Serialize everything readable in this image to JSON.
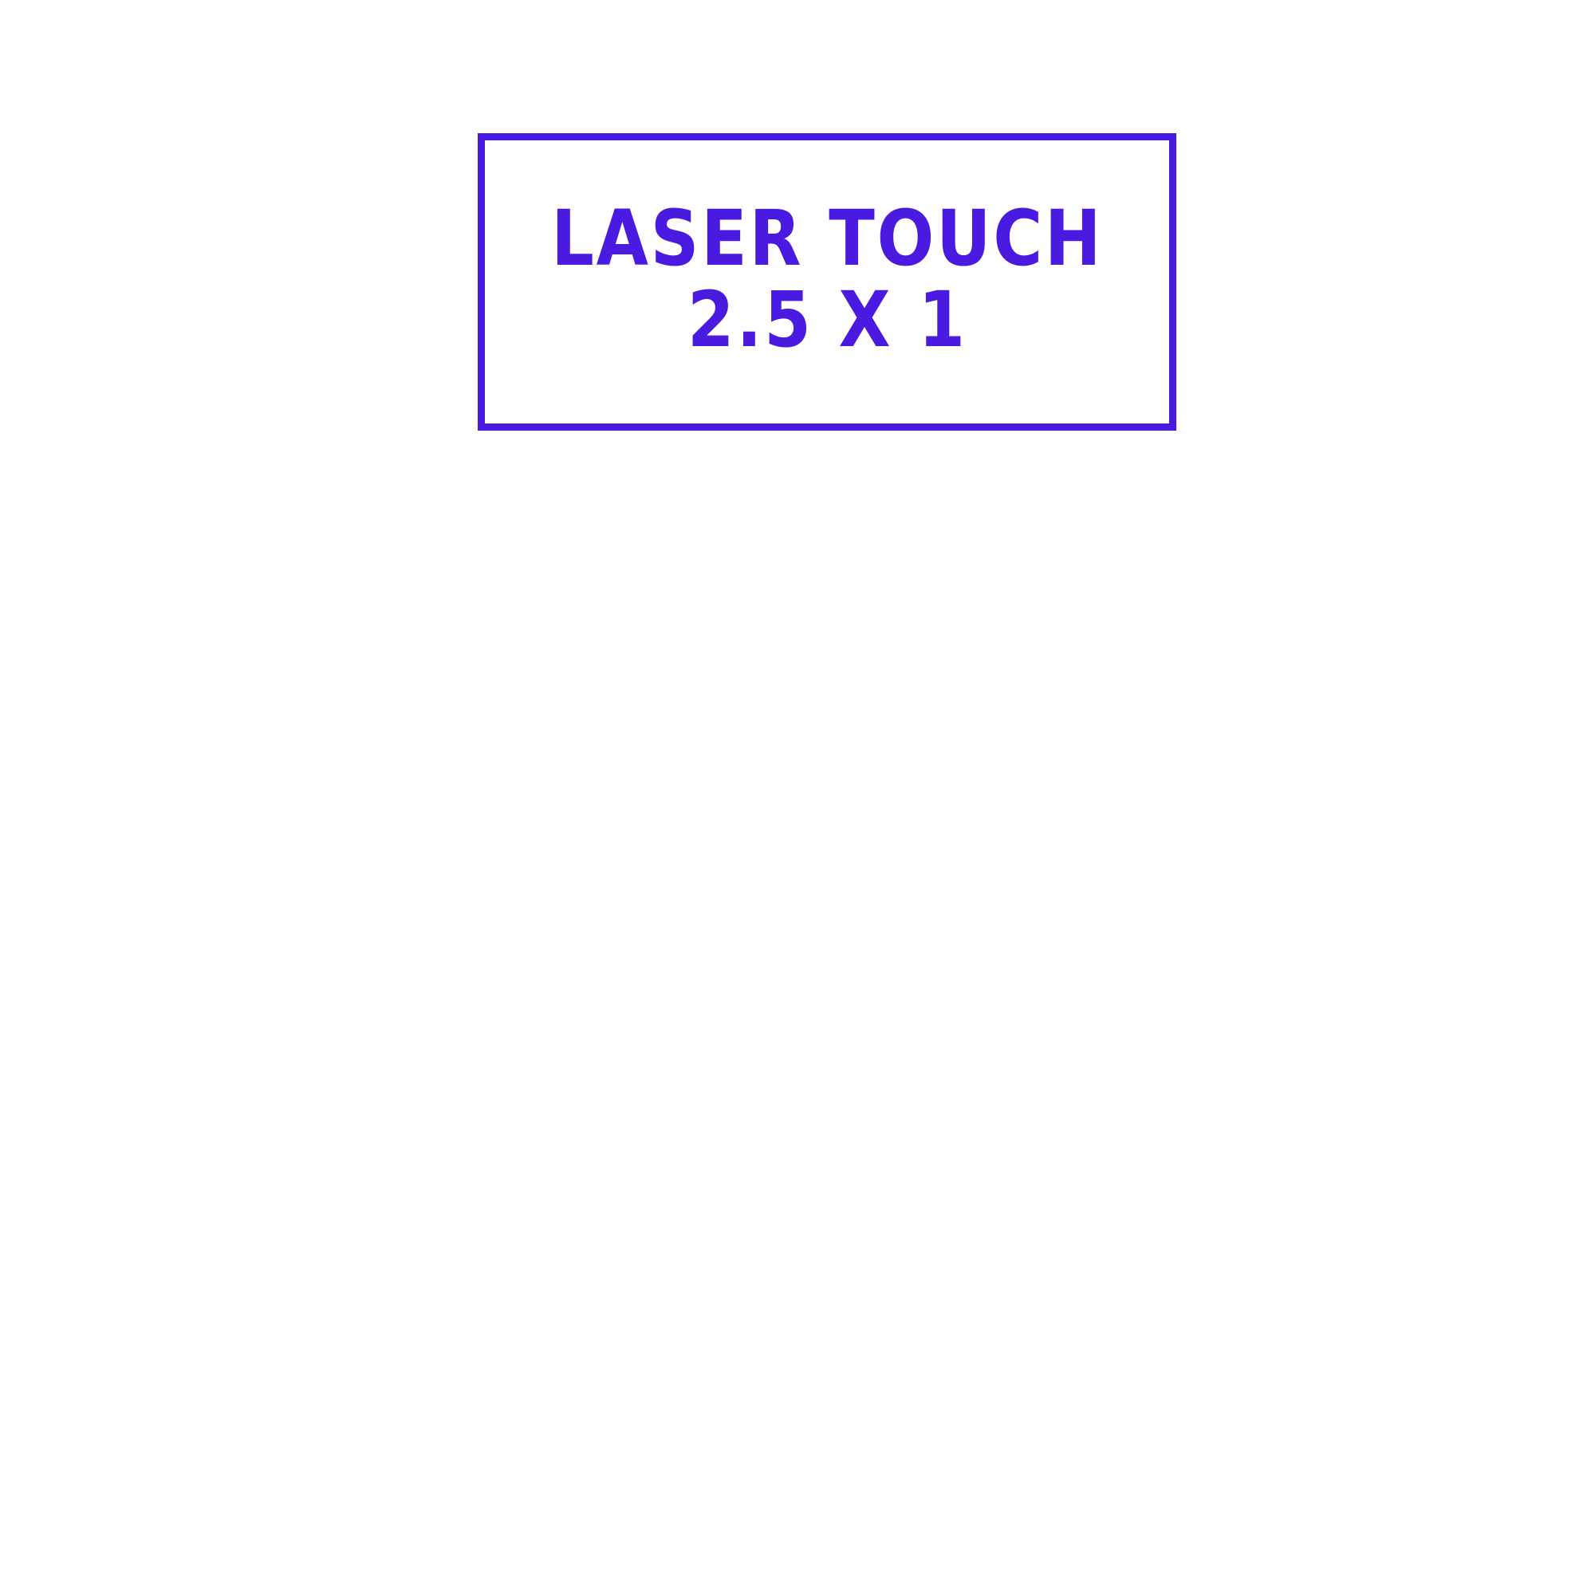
{
  "label": {
    "line1": "LASER TOUCH",
    "line2": "2.5 X 1"
  },
  "colors": {
    "accent": "#4a1ae0",
    "background": "#ffffff"
  }
}
